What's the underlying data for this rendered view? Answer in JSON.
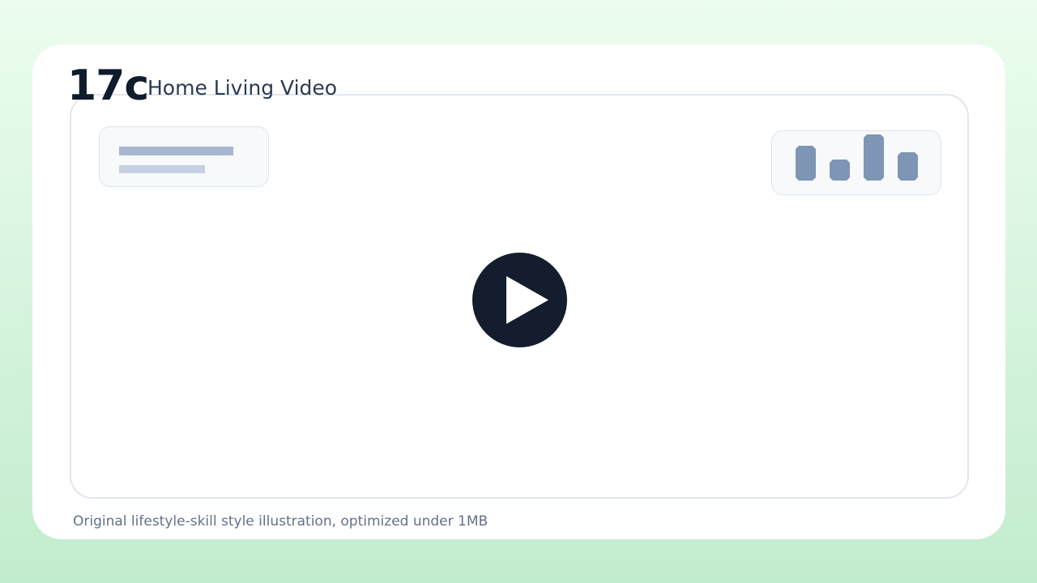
{
  "header": {
    "brand": "17c",
    "title": "Home Living Video"
  },
  "video": {
    "play_icon": "play-icon",
    "overlay_stats": {
      "icon": "bar-chart-icon",
      "bar_levels": [
        0.75,
        0.45,
        1.0,
        0.62
      ]
    }
  },
  "caption": "Original lifestyle-skill style illustration, optimized under 1MB",
  "colors": {
    "background_top": "#ecfdee",
    "background_bottom": "#c2ecce",
    "card": "#ffffff",
    "play_button": "#141d2e",
    "bar": "#7f95b6",
    "title": "#2b3a52",
    "caption": "#637189"
  }
}
